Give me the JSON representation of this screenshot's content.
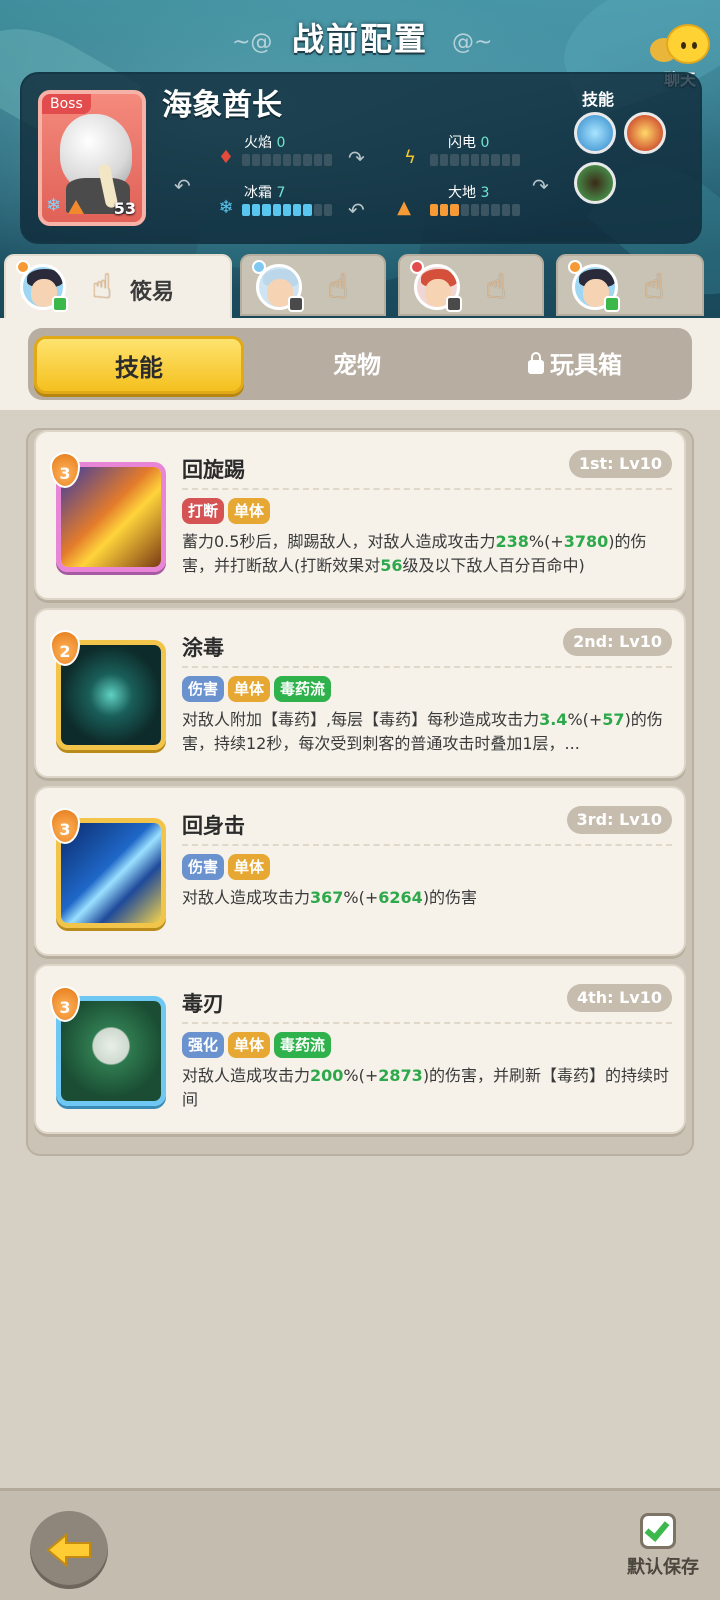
{
  "header": {
    "title": "战前配置",
    "chat_label": "聊天"
  },
  "boss": {
    "tag": "Boss",
    "name": "海象酋长",
    "level": "53",
    "skills_label": "技能",
    "stats": [
      {
        "label": "火焰",
        "value": "0",
        "filled": 0,
        "total": 9,
        "color": "#e44b3a",
        "icon": "fire-icon"
      },
      {
        "label": "闪电",
        "value": "0",
        "filled": 0,
        "total": 9,
        "color": "#f4c82a",
        "icon": "lightning-icon"
      },
      {
        "label": "冰霜",
        "value": "7",
        "filled": 7,
        "total": 9,
        "color": "#59c6f0",
        "icon": "snowflake-icon"
      },
      {
        "label": "大地",
        "value": "3",
        "filled": 3,
        "total": 9,
        "color": "#f59a35",
        "icon": "mountain-icon"
      }
    ]
  },
  "heroes": [
    {
      "name": "筱易",
      "active": true
    },
    {
      "name": "",
      "active": false
    },
    {
      "name": "",
      "active": false
    },
    {
      "name": "",
      "active": false
    }
  ],
  "categories": [
    {
      "label": "技能",
      "active": true
    },
    {
      "label": "宠物",
      "active": false
    },
    {
      "label": "玩具箱",
      "active": false,
      "locked": true
    }
  ],
  "skills": [
    {
      "name": "回旋踢",
      "rank": "3",
      "slot": "1st: Lv10",
      "tags": [
        {
          "text": "打断",
          "color": "red"
        },
        {
          "text": "单体",
          "color": "yellow"
        }
      ],
      "desc_parts": [
        {
          "t": "蓄力0.5秒后，脚踢敌人，对敌人造成攻击力",
          "h": false
        },
        {
          "t": "238",
          "h": true
        },
        {
          "t": "%(+",
          "h": false
        },
        {
          "t": "3780",
          "h": true
        },
        {
          "t": ")的伤害，并打断敌人(打断效果对",
          "h": false
        },
        {
          "t": "56",
          "h": true
        },
        {
          "t": "级及以下敌人百分百命中)",
          "h": false
        }
      ]
    },
    {
      "name": "涂毒",
      "rank": "2",
      "slot": "2nd: Lv10",
      "tags": [
        {
          "text": "伤害",
          "color": "blue"
        },
        {
          "text": "单体",
          "color": "yellow"
        },
        {
          "text": "毒药流",
          "color": "green"
        }
      ],
      "desc_parts": [
        {
          "t": "对敌人附加【毒药】,每层【毒药】每秒造成攻击力",
          "h": false
        },
        {
          "t": "3.4",
          "h": true
        },
        {
          "t": "%(+",
          "h": false
        },
        {
          "t": "57",
          "h": true
        },
        {
          "t": ")的伤害，持续12秒，每次受到刺客的普通攻击时叠加1层，...",
          "h": false
        }
      ]
    },
    {
      "name": "回身击",
      "rank": "3",
      "slot": "3rd: Lv10",
      "tags": [
        {
          "text": "伤害",
          "color": "blue"
        },
        {
          "text": "单体",
          "color": "yellow"
        }
      ],
      "desc_parts": [
        {
          "t": "对敌人造成攻击力",
          "h": false
        },
        {
          "t": "367",
          "h": true
        },
        {
          "t": "%(+",
          "h": false
        },
        {
          "t": "6264",
          "h": true
        },
        {
          "t": ")的伤害",
          "h": false
        }
      ]
    },
    {
      "name": "毒刃",
      "rank": "3",
      "slot": "4th: Lv10",
      "tags": [
        {
          "text": "强化",
          "color": "blue"
        },
        {
          "text": "单体",
          "color": "yellow"
        },
        {
          "text": "毒药流",
          "color": "green"
        }
      ],
      "desc_parts": [
        {
          "t": "对敌人造成攻击力",
          "h": false
        },
        {
          "t": "200",
          "h": true
        },
        {
          "t": "%(+",
          "h": false
        },
        {
          "t": "2873",
          "h": true
        },
        {
          "t": ")的伤害，并刷新【毒药】的持续时间",
          "h": false
        }
      ]
    }
  ],
  "footer": {
    "save_label": "默认保存"
  }
}
